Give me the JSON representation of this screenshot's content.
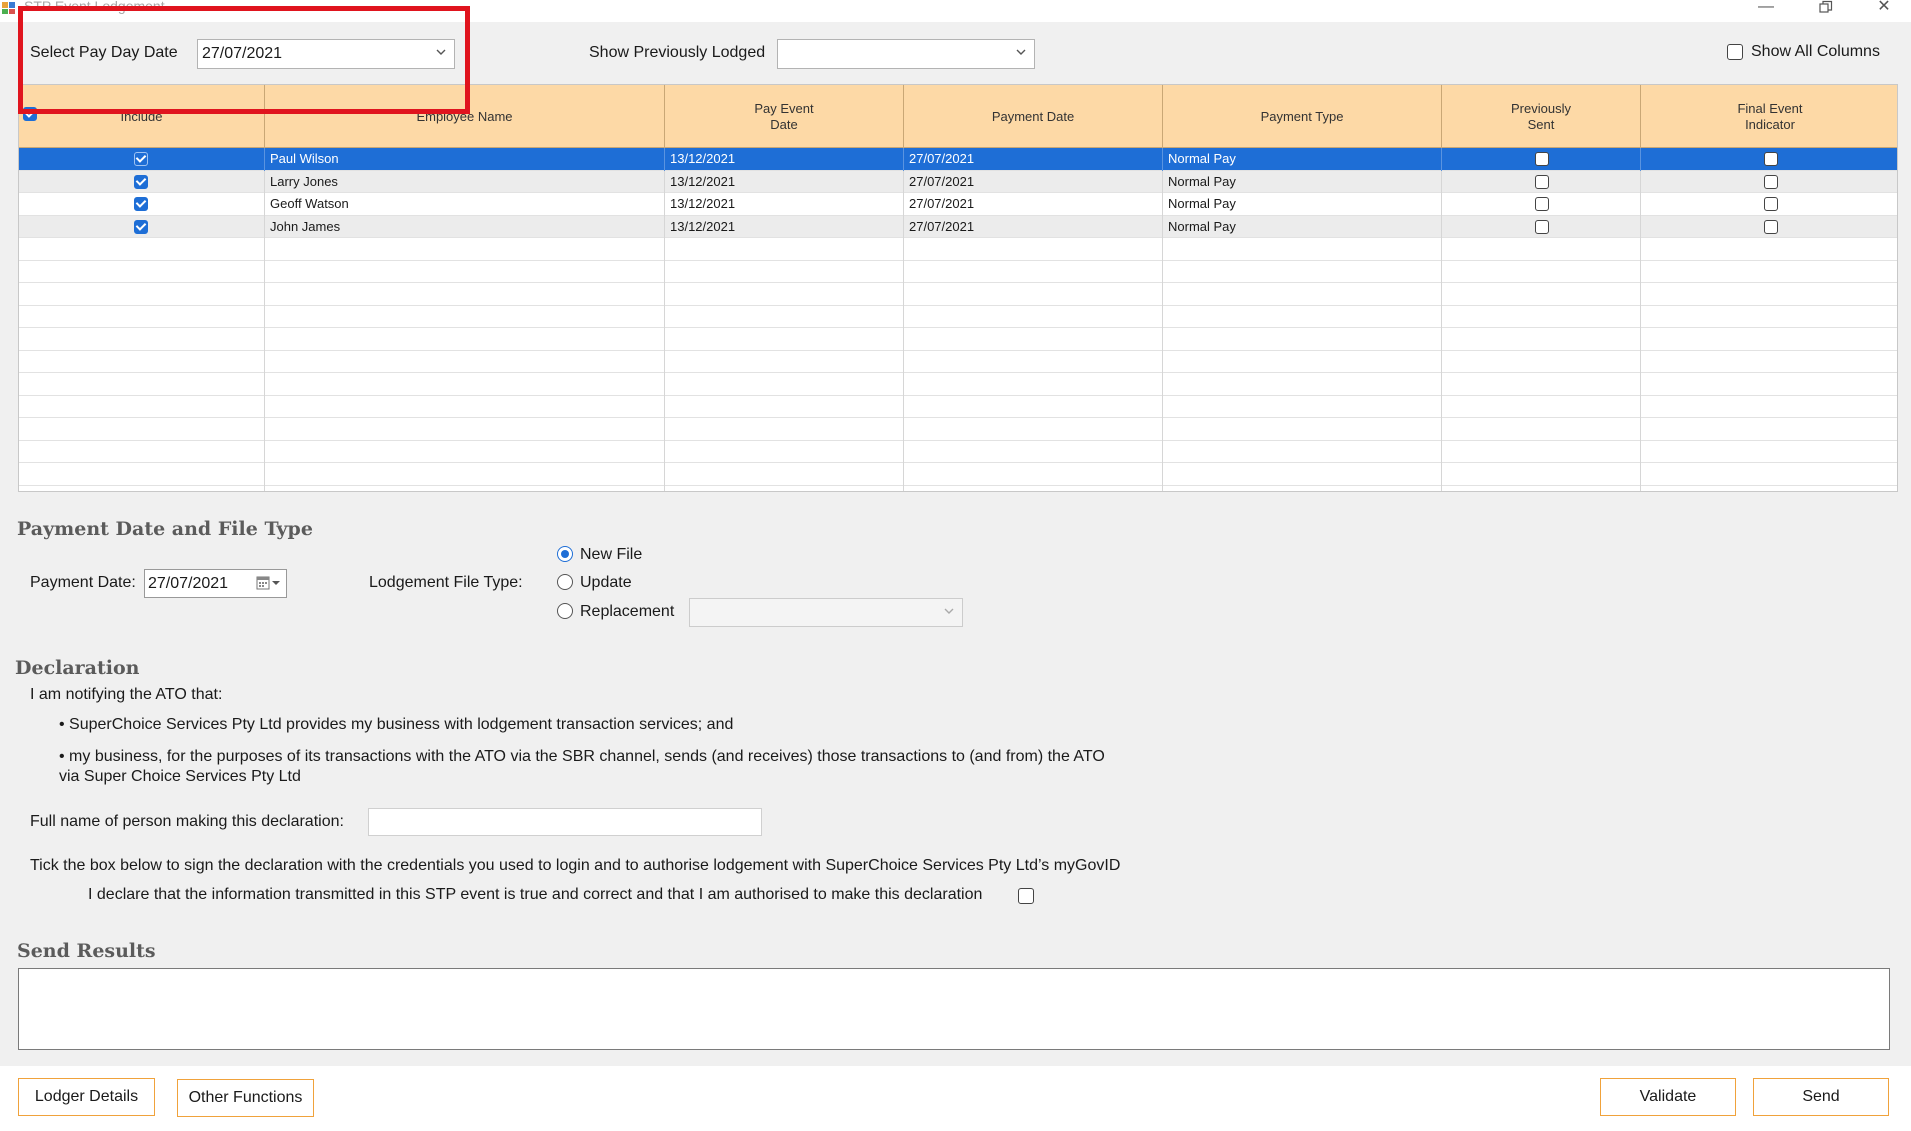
{
  "window": {
    "title": "STP Event Lodgement"
  },
  "topbar": {
    "pay_day_label": "Select Pay Day Date",
    "pay_day_value": "27/07/2021",
    "prev_lodged_label": "Show Previously Lodged",
    "prev_lodged_value": "",
    "show_all_columns_label": "Show All Columns",
    "show_all_columns_checked": false
  },
  "grid": {
    "columns": [
      "Include",
      "Employee Name",
      "Pay Event Date",
      "Payment Date",
      "Payment Type",
      "Previously Sent",
      "Final Event Indicator"
    ],
    "rows": [
      {
        "include": true,
        "employee": "Paul Wilson",
        "pay_event_date": "13/12/2021",
        "payment_date": "27/07/2021",
        "payment_type": "Normal Pay",
        "previously_sent": false,
        "final_event": false,
        "selected": true
      },
      {
        "include": true,
        "employee": "Larry Jones",
        "pay_event_date": "13/12/2021",
        "payment_date": "27/07/2021",
        "payment_type": "Normal Pay",
        "previously_sent": false,
        "final_event": false,
        "selected": false
      },
      {
        "include": true,
        "employee": "Geoff Watson",
        "pay_event_date": "13/12/2021",
        "payment_date": "27/07/2021",
        "payment_type": "Normal Pay",
        "previously_sent": false,
        "final_event": false,
        "selected": false
      },
      {
        "include": true,
        "employee": "John James",
        "pay_event_date": "13/12/2021",
        "payment_date": "27/07/2021",
        "payment_type": "Normal Pay",
        "previously_sent": false,
        "final_event": false,
        "selected": false
      }
    ]
  },
  "payment": {
    "section_title": "Payment Date and File Type",
    "date_label": "Payment Date:",
    "date_value": "27/07/2021",
    "file_type_label": "Lodgement File Type:",
    "options": [
      {
        "label": "New File",
        "selected": true
      },
      {
        "label": "Update",
        "selected": false
      },
      {
        "label": "Replacement",
        "selected": false
      }
    ],
    "replacement_value": ""
  },
  "declaration": {
    "section_title": "Declaration",
    "intro": "I am notifying the ATO that:",
    "bullet1": "• SuperChoice Services Pty Ltd provides my business with lodgement transaction services; and",
    "bullet2_line1": "• my business, for the purposes of its transactions with the ATO via the SBR channel, sends (and receives) those transactions to (and from) the ATO",
    "bullet2_line2": "via Super Choice Services Pty Ltd",
    "fullname_label": "Full name of person making this declaration:",
    "fullname_value": "",
    "tick_text": "Tick the box below to sign the declaration with the credentials you used to login and to authorise lodgement with SuperChoice Services Pty Ltd’s myGovID",
    "declare_text": "I declare that the information transmitted in this STP event is true and correct and that I am authorised to make this declaration",
    "declare_checked": false
  },
  "results": {
    "section_title": "Send Results",
    "text": ""
  },
  "footer": {
    "lodger_details": "Lodger Details",
    "other_functions": "Other Functions",
    "validate": "Validate",
    "send": "Send"
  },
  "colors": {
    "accent": "#1e6ed6",
    "header_bg": "#fdd9a6",
    "button_border": "#f0a23b",
    "highlight": "#e0141e"
  }
}
